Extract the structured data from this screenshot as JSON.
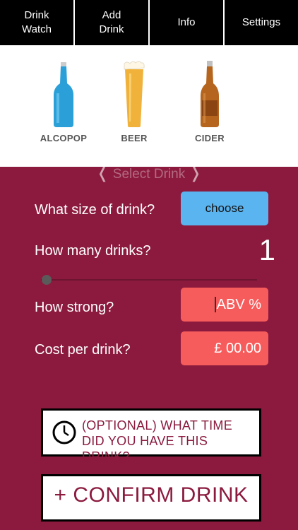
{
  "nav": {
    "tabs": [
      {
        "label": "Drink\nWatch"
      },
      {
        "label": "Add\nDrink"
      },
      {
        "label": "Info"
      },
      {
        "label": "Settings"
      }
    ]
  },
  "drinks": [
    {
      "label": "ALCOPOP"
    },
    {
      "label": "BEER"
    },
    {
      "label": "CIDER"
    }
  ],
  "picker_hint": {
    "left": "❬",
    "text": "Select Drink",
    "right": "❭"
  },
  "form": {
    "size_label": "What size of drink?",
    "size_value": "choose",
    "count_label": "How many drinks?",
    "count_value": "1",
    "count_slider_fraction": 0.0,
    "strength_label": "How strong?",
    "strength_placeholder": "ABV %",
    "cost_label": "Cost per drink?",
    "cost_value": "£ 00.00"
  },
  "time_button": {
    "icon": "clock-icon",
    "text": "(OPTIONAL) WHAT TIME\nDID YOU HAVE THIS DRINK?"
  },
  "confirm_button": {
    "text": "+ CONFIRM DRINK"
  },
  "colors": {
    "background": "#8b1a3e",
    "accent_blue": "#5ab4f0",
    "accent_red": "#f75c5c"
  }
}
